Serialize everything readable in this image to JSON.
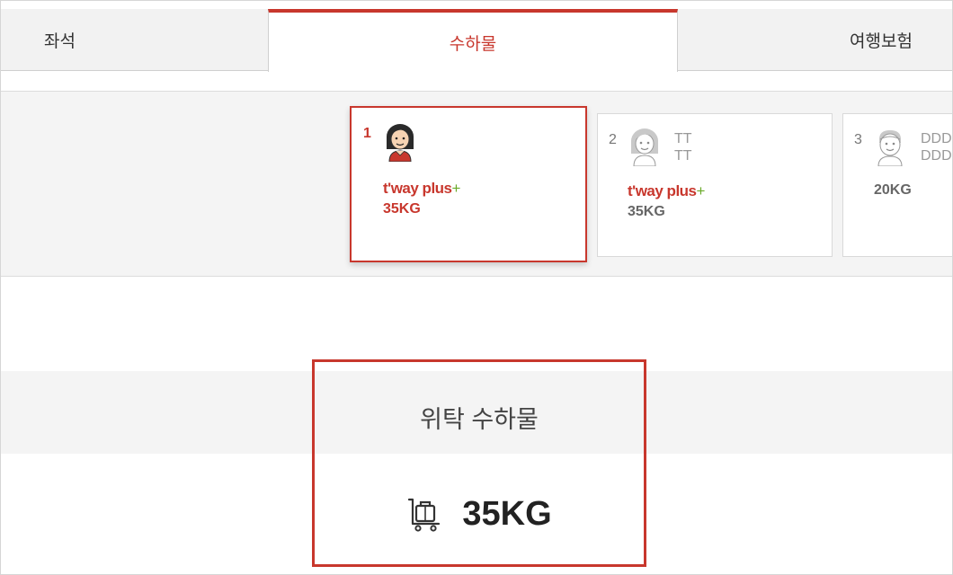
{
  "tabs": [
    {
      "label": "좌석"
    },
    {
      "label": "수하물"
    },
    {
      "label": "여행보험"
    }
  ],
  "passengers": [
    {
      "number": "1",
      "name_line1": "",
      "name_line2": "",
      "brand_main": "t'way plus",
      "brand_plus": "+",
      "weight": "35KG"
    },
    {
      "number": "2",
      "name_line1": "TT",
      "name_line2": "TT",
      "brand_main": "t'way plus",
      "brand_plus": "+",
      "weight": "35KG"
    },
    {
      "number": "3",
      "name_line1": "DDD",
      "name_line2": "DDD",
      "brand_main": "",
      "brand_plus": "",
      "weight": "20KG"
    }
  ],
  "summary": {
    "title": "위탁 수하물",
    "weight": "35KG",
    "icon": "luggage-cart-icon"
  },
  "colors": {
    "accent": "#c8372d",
    "plus_green": "#6aaa2a",
    "band_bg": "#f4f4f4"
  }
}
